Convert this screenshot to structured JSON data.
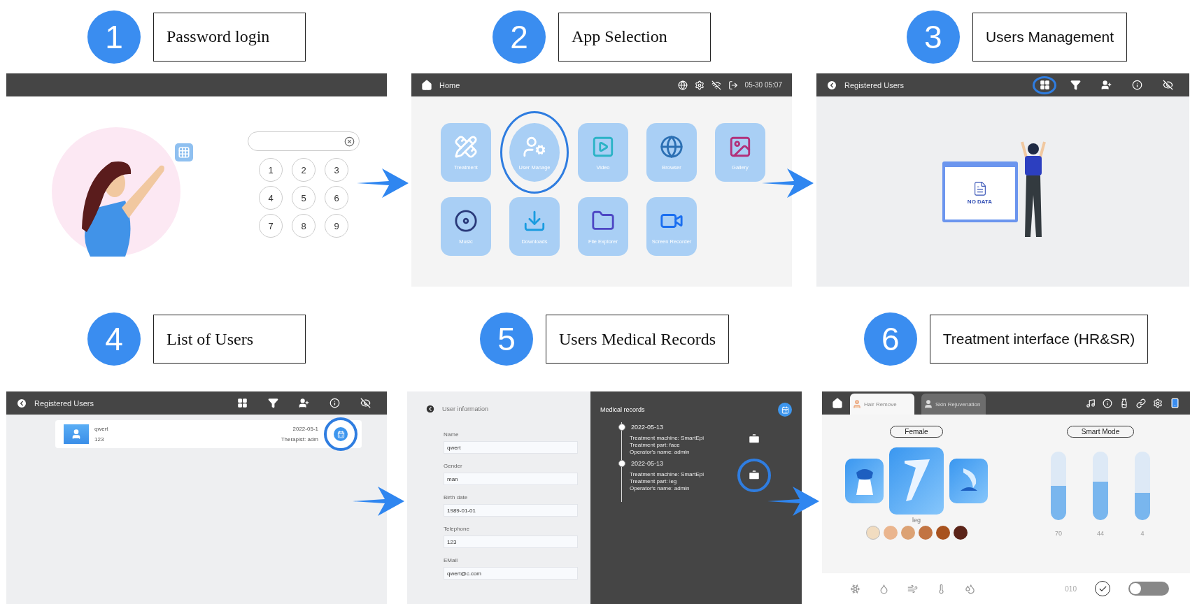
{
  "steps": [
    {
      "number": "1",
      "title": "Password login",
      "screen": {
        "kind": "login",
        "keys": [
          "1",
          "2",
          "3",
          "4",
          "5",
          "6",
          "7",
          "8",
          "9"
        ]
      }
    },
    {
      "number": "2",
      "title": "App Selection",
      "screen": {
        "kind": "home",
        "title": "Home",
        "time": "05-30 05:07",
        "apps": [
          {
            "label": "Treatment",
            "selected": false
          },
          {
            "label": "User Manage",
            "selected": true
          },
          {
            "label": "Video",
            "selected": false
          },
          {
            "label": "Browser",
            "selected": false
          },
          {
            "label": "Gallery",
            "selected": false
          },
          {
            "label": "Music",
            "selected": false
          },
          {
            "label": "Downloads",
            "selected": false
          },
          {
            "label": "File Explorer",
            "selected": false
          },
          {
            "label": "Screen Recorder",
            "selected": false
          }
        ]
      }
    },
    {
      "number": "3",
      "title": "Users Management",
      "screen": {
        "kind": "users",
        "title": "Registered Users",
        "toolbar": [
          {
            "highlighted": true
          },
          {
            "highlighted": false
          },
          {
            "highlighted": false
          },
          {
            "highlighted": false
          },
          {
            "highlighted": false
          }
        ],
        "empty_text": "NO DATA"
      }
    },
    {
      "number": "4",
      "title": "List of Users",
      "screen": {
        "kind": "user_list",
        "title": "Registered Users",
        "toolbar": [
          {
            "highlighted": false
          },
          {
            "highlighted": false
          },
          {
            "highlighted": false
          },
          {
            "highlighted": false
          },
          {
            "highlighted": false
          }
        ],
        "users": [
          {
            "name": "qwert",
            "code": "123",
            "date": "2022-05-1",
            "operator": "Therapist: adm",
            "highlighted": true
          }
        ]
      }
    },
    {
      "number": "5",
      "title": "Users Medical Records",
      "screen": {
        "kind": "records",
        "info_title": "User information",
        "fields": [
          {
            "label": "Name",
            "value": "qwert"
          },
          {
            "label": "Gender",
            "value": "man"
          },
          {
            "label": "Birth date",
            "value": "1989-01-01"
          },
          {
            "label": "Telephone",
            "value": "123"
          },
          {
            "label": "EMail",
            "value": "qwert@c.com"
          }
        ],
        "records_title": "Medical records",
        "records": [
          {
            "date": "2022-05-13",
            "lines": [
              "Treatment machine: SmartEpi",
              "Treatment part: face",
              "Operator's name: admin"
            ],
            "highlighted": false
          },
          {
            "date": "2022-05-13",
            "lines": [
              "Treatment machine: SmartEpi",
              "Treatment part: leg",
              "Operator's name: admin"
            ],
            "highlighted": true
          }
        ]
      }
    },
    {
      "number": "6",
      "title": "Treatment interface (HR&SR)",
      "screen": {
        "kind": "treatment",
        "tabs": [
          {
            "label": "Hair Remove",
            "selected": true
          },
          {
            "label": "Skin Rejuvenation",
            "selected": false
          }
        ],
        "gender": "Female",
        "mode": "Smart Mode",
        "parts": [
          {
            "selected": false
          },
          {
            "selected": true
          },
          {
            "selected": false
          }
        ],
        "part_label": "leg",
        "skin_tones": [
          {
            "color": "#f1dcc0",
            "selected": true
          },
          {
            "color": "#eab58e",
            "selected": false
          },
          {
            "color": "#dca274",
            "selected": false
          },
          {
            "color": "#c27442",
            "selected": false
          },
          {
            "color": "#a8521e",
            "selected": false
          },
          {
            "color": "#5b2419",
            "selected": false
          }
        ],
        "gauges": [
          {
            "level": 0.5,
            "reading": "70"
          },
          {
            "level": 0.56,
            "reading": "44"
          },
          {
            "level": 0.4,
            "reading": "4"
          }
        ],
        "counter": "010",
        "toggle": {
          "on": false
        }
      }
    }
  ]
}
